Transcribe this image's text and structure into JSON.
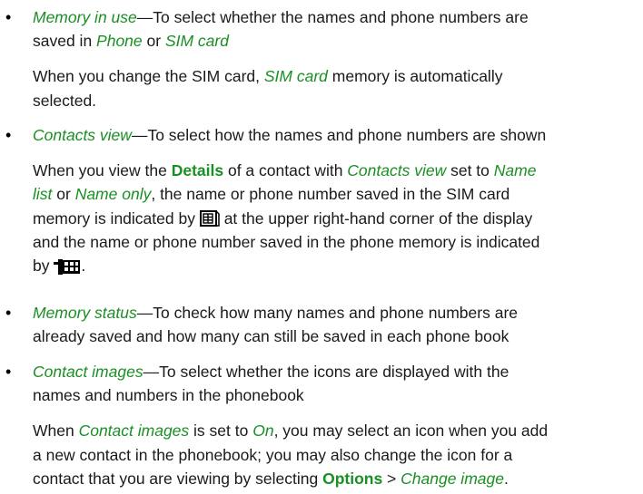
{
  "colors": {
    "accent": "#1a8f24",
    "text": "#1a1a1a"
  },
  "items": [
    {
      "bullet": "•",
      "p1": {
        "l1": {
          "term": "Memory in use",
          "t1": "—To select whether the names and phone numbers are"
        },
        "l2": {
          "t1": "saved in ",
          "a1": "Phone",
          "t2": " or ",
          "a2": "SIM card"
        }
      },
      "p2": {
        "l1": {
          "t1": "When you change the SIM card, ",
          "a1": "SIM card",
          "t2": " memory is automatically"
        },
        "l2": {
          "t1": "selected."
        }
      }
    },
    {
      "bullet": "•",
      "p1": {
        "l1": {
          "term": "Contacts view",
          "t1": "—To select how the names and phone numbers are shown"
        }
      },
      "p2": {
        "l1": {
          "t1": "When you view the ",
          "b1": "Details",
          "t2": " of a contact with ",
          "a1": "Contacts view",
          "t3": " set to ",
          "a2": "Name"
        },
        "l2": {
          "a1": "list",
          "t1": " or ",
          "a2": "Name only",
          "t2": ", the name or phone number saved in the SIM card"
        },
        "l3": {
          "t1": "memory is indicated by ",
          "icon": "sim-card-memory-icon",
          "t2": " at the upper right-hand corner of the display"
        },
        "l4": {
          "t1": "and the name or phone number saved in the phone memory is indicated"
        },
        "l5": {
          "t1": "by ",
          "icon": "phone-memory-icon",
          "t2": "."
        }
      }
    },
    {
      "bullet": "•",
      "p1": {
        "l1": {
          "term": "Memory status",
          "t1": "—To check how many names and phone numbers are"
        },
        "l2": {
          "t1": "already saved and how many can still be saved in each phone book"
        }
      }
    },
    {
      "bullet": "•",
      "p1": {
        "l1": {
          "term": "Contact images",
          "t1": "—To select whether the icons are displayed with the"
        },
        "l2": {
          "t1": "names and numbers in the phonebook"
        }
      },
      "p2": {
        "l1": {
          "t1": "When ",
          "a1": "Contact images",
          "t2": " is set to ",
          "a2": "On",
          "t3": ", you may select an icon when you add"
        },
        "l2": {
          "t1": "a new contact in the phonebook; you may also change the icon for a"
        },
        "l3": {
          "t1": "contact that you are viewing by selecting ",
          "b1": "Options",
          "t2": " > ",
          "a1": "Change image",
          "t3": "."
        }
      }
    }
  ]
}
